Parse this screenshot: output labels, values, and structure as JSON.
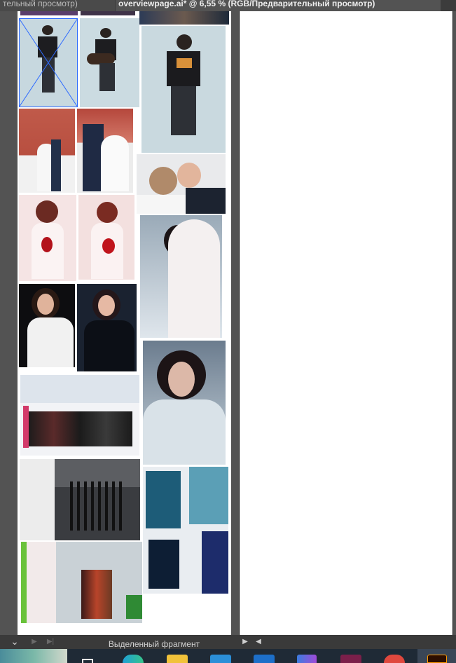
{
  "tabs": {
    "left_label": "тельный просмотр)",
    "right_label": "overviewpage.ai* @ 6,55 % (RGB/Предварительный просмотр)"
  },
  "status_bar": {
    "selection_label": "Выделенный фрагмент"
  },
  "icons": {
    "scroll_right": "▶",
    "scroll_left": "◀",
    "dropdown": "⌄",
    "nav_next": "▶",
    "nav_last": "▶|"
  },
  "colors": {
    "selection_outline": "#2e6bff",
    "canvas_bg": "#535353",
    "artboard_bg": "#ffffff",
    "taskbar_bg": "#1f2a36"
  },
  "photos": [
    {
      "name": "photo-guy-on-stool-selected",
      "theme": "light studio portrait"
    },
    {
      "name": "photo-guy-with-guitar",
      "theme": "light studio portrait"
    },
    {
      "name": "photo-guy-on-stool-large",
      "theme": "light studio portrait"
    },
    {
      "name": "photo-wedding-couple-church",
      "theme": "wedding winter"
    },
    {
      "name": "photo-wedding-couple-embrace",
      "theme": "wedding winter"
    },
    {
      "name": "photo-wedding-kiss",
      "theme": "wedding"
    },
    {
      "name": "photo-woman-red-flower-1",
      "theme": "pink portrait"
    },
    {
      "name": "photo-woman-red-flower-2",
      "theme": "pink portrait"
    },
    {
      "name": "photo-woman-white-hood",
      "theme": "winter portrait"
    },
    {
      "name": "photo-woman-white-sweater",
      "theme": "dark portrait"
    },
    {
      "name": "photo-woman-snow-jacket",
      "theme": "winter portrait"
    },
    {
      "name": "photo-woman-snow-scarf",
      "theme": "winter portrait"
    },
    {
      "name": "photo-gallery-crowd",
      "theme": "gallery event"
    },
    {
      "name": "photo-gallery-from-above",
      "theme": "gallery event"
    },
    {
      "name": "photo-gallery-art-panels",
      "theme": "gallery art"
    },
    {
      "name": "photo-gallery-corridor",
      "theme": "gallery event"
    }
  ]
}
